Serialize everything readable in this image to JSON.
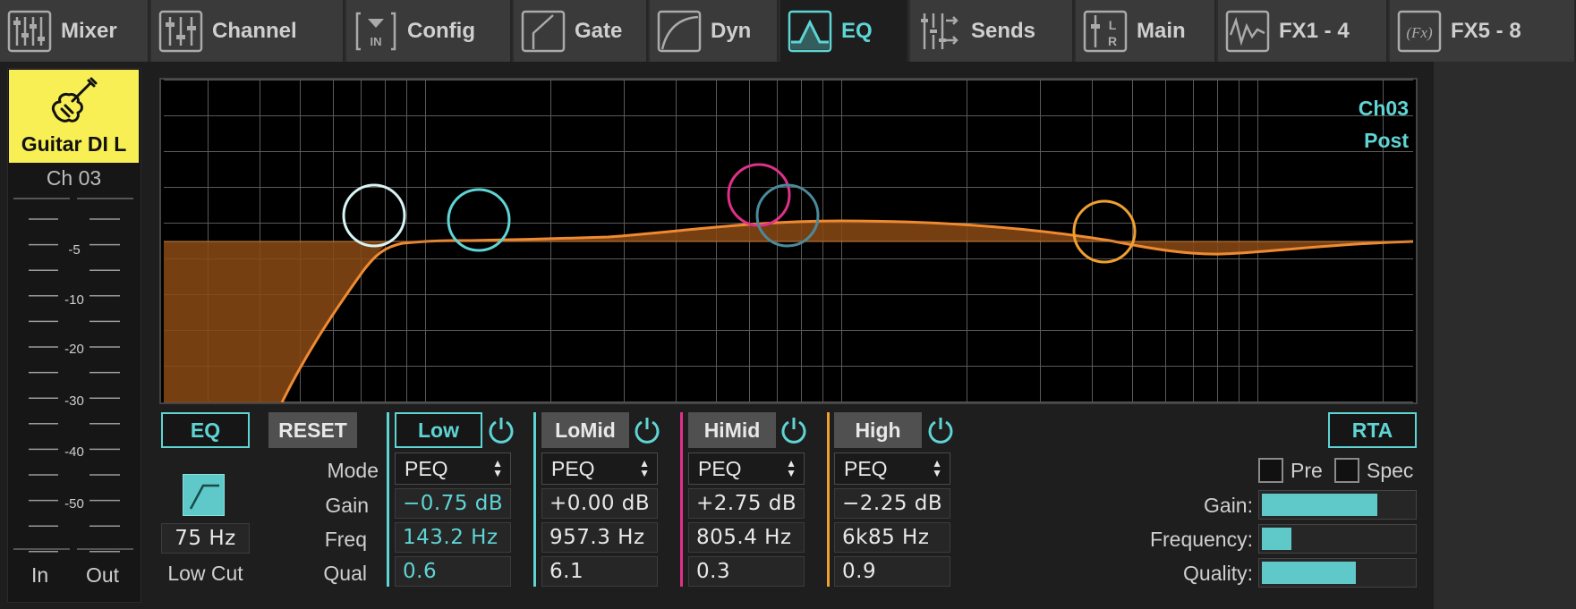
{
  "tabs": [
    {
      "label": "Mixer",
      "icon": "mixer-icon"
    },
    {
      "label": "Channel",
      "icon": "channel-icon"
    },
    {
      "label": "Config",
      "icon": "config-input-icon"
    },
    {
      "label": "Gate",
      "icon": "gate-icon"
    },
    {
      "label": "Dyn",
      "icon": "dynamics-icon"
    },
    {
      "label": "EQ",
      "icon": "eq-icon",
      "active": true
    },
    {
      "label": "Sends",
      "icon": "sends-icon"
    },
    {
      "label": "Main",
      "icon": "main-lr-icon"
    },
    {
      "label": "FX1 - 4",
      "icon": "fx-wave-icon"
    },
    {
      "label": "FX5 - 8",
      "icon": "fx-icon"
    }
  ],
  "channel": {
    "name": "Guitar DI L",
    "number": "Ch 03",
    "badge_color": "#f8ef55",
    "icon": "electric-guitar-icon",
    "meter_scale": [
      "-5",
      "-10",
      "-20",
      "-30",
      "-40",
      "-50"
    ],
    "in_label": "In",
    "out_label": "Out"
  },
  "graph": {
    "channel_tag": "Ch03",
    "mode_tag": "Post",
    "band_colors": {
      "low": "#d8f4f4",
      "lowmid": "#5fd4d4",
      "himid": "#e0308a",
      "high": "#f0a030",
      "extra": "#4a8a9a"
    }
  },
  "controls": {
    "eq_button": "EQ",
    "reset_button": "RESET",
    "lowcut_freq": "75 Hz",
    "lowcut_label": "Low Cut",
    "row_labels": {
      "mode": "Mode",
      "gain": "Gain",
      "freq": "Freq",
      "qual": "Qual"
    },
    "bands": [
      {
        "name": "Low",
        "mode": "PEQ",
        "gain": "−0.75 dB",
        "freq": "143.2 Hz",
        "qual": "0.6",
        "color": "#5fd4d4"
      },
      {
        "name": "LoMid",
        "mode": "PEQ",
        "gain": "+0.00 dB",
        "freq": "957.3 Hz",
        "qual": "6.1",
        "color": "#5fd4d4"
      },
      {
        "name": "HiMid",
        "mode": "PEQ",
        "gain": "+2.75 dB",
        "freq": "805.4 Hz",
        "qual": "0.3",
        "color": "#e0308a"
      },
      {
        "name": "High",
        "mode": "PEQ",
        "gain": "−2.25 dB",
        "freq": "6k85 Hz",
        "qual": "0.9",
        "color": "#f0a030"
      }
    ]
  },
  "rta": {
    "button": "RTA",
    "pre_label": "Pre",
    "spec_label": "Spec",
    "gain_label": "Gain:",
    "frequency_label": "Frequency:",
    "quality_label": "Quality:",
    "gain_level": 0.77,
    "frequency_level": 0.2,
    "quality_level": 0.63
  }
}
